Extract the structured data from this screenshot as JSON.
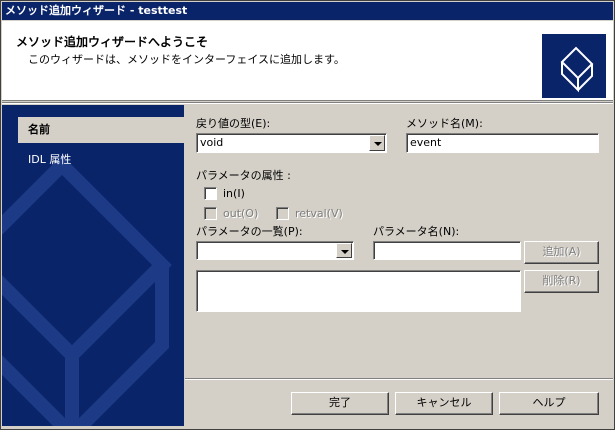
{
  "window": {
    "title": "メソッド追加ウィザード - testtest"
  },
  "header": {
    "title": "メソッド追加ウィザードへようこそ",
    "subtitle": "このウィザードは、メソッドをインターフェイスに追加します。"
  },
  "sidebar": {
    "items": [
      {
        "label": "名前",
        "active": true
      },
      {
        "label": "IDL 属性",
        "active": false
      }
    ]
  },
  "form": {
    "return_type_label": "戻り値の型(E):",
    "return_type_value": "void",
    "method_name_label": "メソッド名(M):",
    "method_name_value": "event",
    "param_attr_label": "パラメータの属性 :",
    "in_label": "in(I)",
    "out_label": "out(O)",
    "retval_label": "retval(V)",
    "param_list_label": "パラメータの一覧(P):",
    "param_list_value": "",
    "param_name_label": "パラメータ名(N):",
    "param_name_value": "",
    "add_button": "追加(A)",
    "delete_button": "削除(R)"
  },
  "footer": {
    "finish_button": "完了",
    "cancel_button": "キャンセル",
    "help_button": "ヘルプ"
  },
  "colors": {
    "accent": "#0a246a",
    "face": "#d4d0c8"
  }
}
